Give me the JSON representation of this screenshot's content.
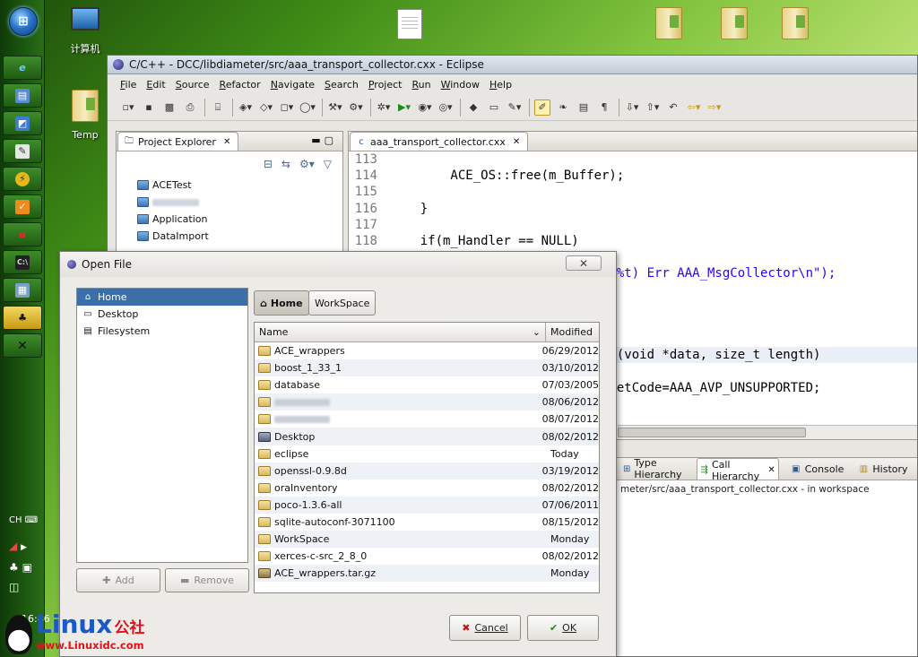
{
  "desktop": {
    "icons": [
      {
        "label": "计算机"
      },
      {
        "label": "Temp"
      }
    ]
  },
  "taskbar": {
    "lang": "CH",
    "clock": "16:46"
  },
  "eclipse": {
    "title": "C/C++ - DCC/libdiameter/src/aaa_transport_collector.cxx - Eclipse",
    "menu": [
      "File",
      "Edit",
      "Source",
      "Refactor",
      "Navigate",
      "Search",
      "Project",
      "Run",
      "Window",
      "Help"
    ],
    "project_explorer": {
      "tab": "Project Explorer",
      "items": [
        "ACETest",
        "",
        "Application",
        "DataImport"
      ]
    },
    "editor": {
      "tab": "aaa_transport_collector.cxx",
      "lines": [
        {
          "n": "113",
          "t": ""
        },
        {
          "n": "114",
          "t": "        ACE_OS::free(m_Buffer);"
        },
        {
          "n": "115",
          "t": ""
        },
        {
          "n": "116",
          "t": "    }"
        },
        {
          "n": "117",
          "t": ""
        },
        {
          "n": "118",
          "t": "    if(m_Handler == NULL)"
        },
        {
          "n": "",
          "t": ""
        },
        {
          "n": "",
          "t": "                              %t) Err AAA_MsgCollector\\n\");"
        },
        {
          "n": "",
          "t": ""
        },
        {
          "n": "",
          "t": ""
        },
        {
          "n": "",
          "t": ""
        },
        {
          "n": "",
          "t": ""
        },
        {
          "n": "",
          "t": "                              (void *data, size_t length)"
        },
        {
          "n": "",
          "t": ""
        },
        {
          "n": "",
          "t": "                              etCode=AAA_AVP_UNSUPPORTED;"
        }
      ]
    },
    "bottom": {
      "tabs": [
        "Type Hierarchy",
        "Call Hierarchy",
        "Console",
        "History"
      ],
      "description": "meter/src/aaa_transport_collector.cxx - in workspace"
    }
  },
  "dialog": {
    "title": "Open File",
    "places": [
      "Home",
      "Desktop",
      "Filesystem"
    ],
    "path_buttons": [
      "Home",
      "WorkSpace"
    ],
    "columns": {
      "name": "Name",
      "modified": "Modified"
    },
    "files": [
      {
        "name": "ACE_wrappers",
        "modified": "06/29/2012",
        "type": "folder"
      },
      {
        "name": "boost_1_33_1",
        "modified": "03/10/2012",
        "type": "folder"
      },
      {
        "name": "database",
        "modified": "07/03/2005",
        "type": "folder"
      },
      {
        "name": "",
        "modified": "08/06/2012",
        "type": "folder"
      },
      {
        "name": "",
        "modified": "08/07/2012",
        "type": "folder"
      },
      {
        "name": "Desktop",
        "modified": "08/02/2012",
        "type": "desktop"
      },
      {
        "name": "eclipse",
        "modified": "Today",
        "type": "folder"
      },
      {
        "name": "openssl-0.9.8d",
        "modified": "03/19/2012",
        "type": "folder"
      },
      {
        "name": "oraInventory",
        "modified": "08/02/2012",
        "type": "folder"
      },
      {
        "name": "poco-1.3.6-all",
        "modified": "07/06/2011",
        "type": "folder"
      },
      {
        "name": "sqlite-autoconf-3071100",
        "modified": "08/15/2012",
        "type": "folder"
      },
      {
        "name": "WorkSpace",
        "modified": "Monday",
        "type": "folder"
      },
      {
        "name": "xerces-c-src_2_8_0",
        "modified": "08/02/2012",
        "type": "folder"
      },
      {
        "name": "ACE_wrappers.tar.gz",
        "modified": "Monday",
        "type": "archive"
      }
    ],
    "add_label": "Add",
    "remove_label": "Remove",
    "cancel_label": "Cancel",
    "ok_label": "OK"
  },
  "watermark": {
    "brand": "Linux",
    "brand_suffix": "公社",
    "url": "www.Linuxidc.com"
  }
}
